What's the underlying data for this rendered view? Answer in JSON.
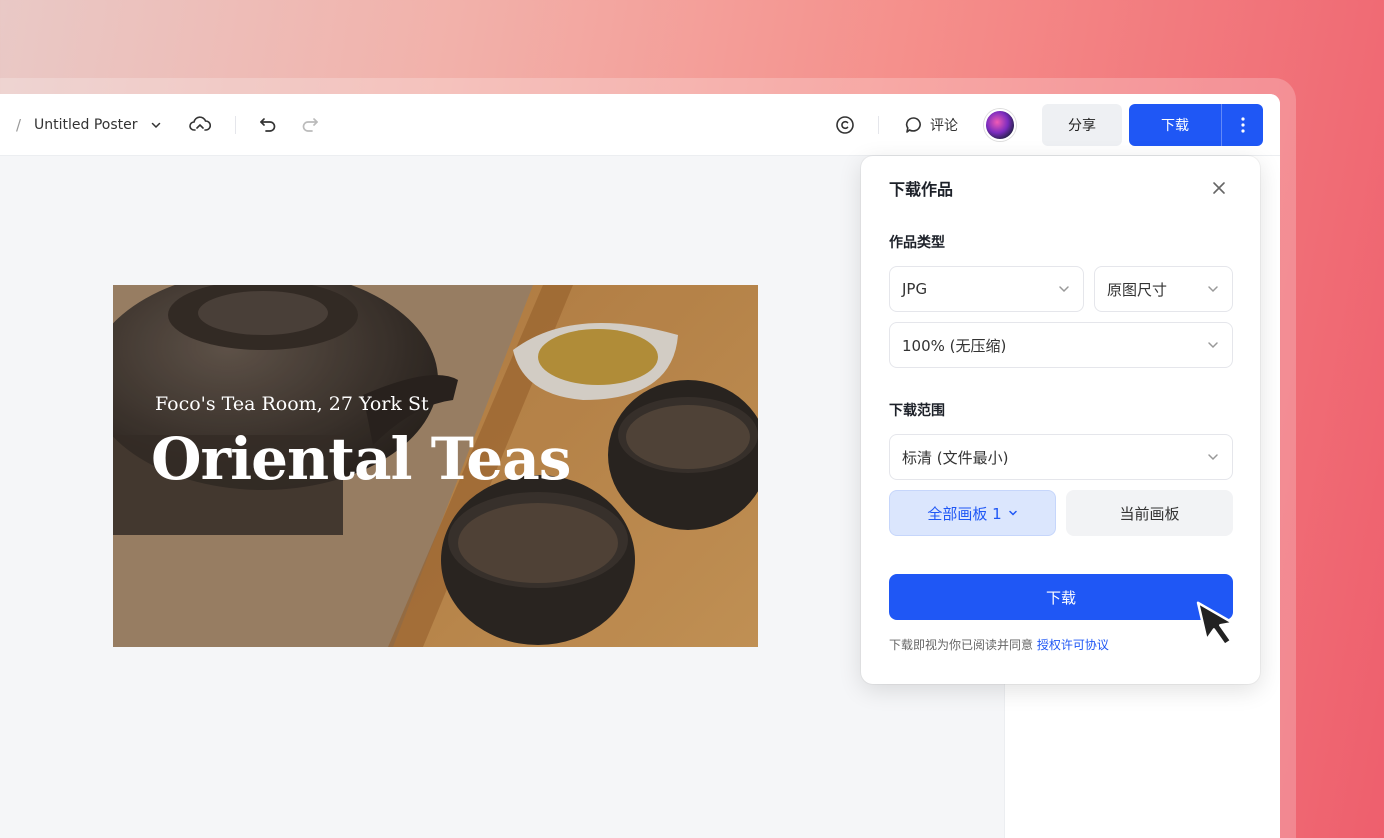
{
  "toolbar": {
    "breadcrumb_sep": "/",
    "document_title": "Untitled Poster",
    "comment_label": "评论",
    "share_label": "分享",
    "download_label": "下载"
  },
  "poster": {
    "subtitle": "Foco's Tea Room, 27 York St",
    "title": "Oriental  Teas"
  },
  "download_dialog": {
    "title": "下载作品",
    "type_section_label": "作品类型",
    "format_select": "JPG",
    "size_select": "原图尺寸",
    "quality_select": "100% (无压缩)",
    "range_section_label": "下载范围",
    "resolution_select": "标清 (文件最小)",
    "all_boards_label": "全部画板 1",
    "current_board_label": "当前画板",
    "download_button": "下载",
    "agreement_text": "下载即视为你已阅读并同意 ",
    "agreement_link": "授权许可协议"
  },
  "colors": {
    "accent": "#1f57f5",
    "accent_light": "#dbe6fd"
  }
}
